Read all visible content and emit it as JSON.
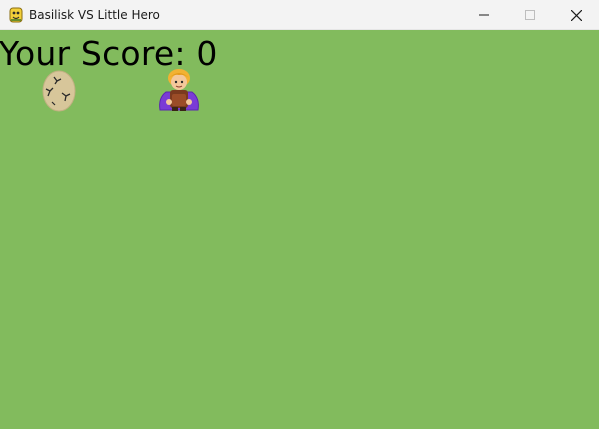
{
  "window": {
    "title": "Basilisk VS Little Hero",
    "background_color": "#82bb5d",
    "icons": {
      "app": "python-snake-icon",
      "minimize": "minimize-icon",
      "maximize": "maximize-icon",
      "close": "close-icon"
    }
  },
  "hud": {
    "score_label": "Your Score:",
    "score_value": "0"
  },
  "sprites": {
    "egg": "basilisk-egg-icon",
    "hero": "little-hero-icon"
  }
}
